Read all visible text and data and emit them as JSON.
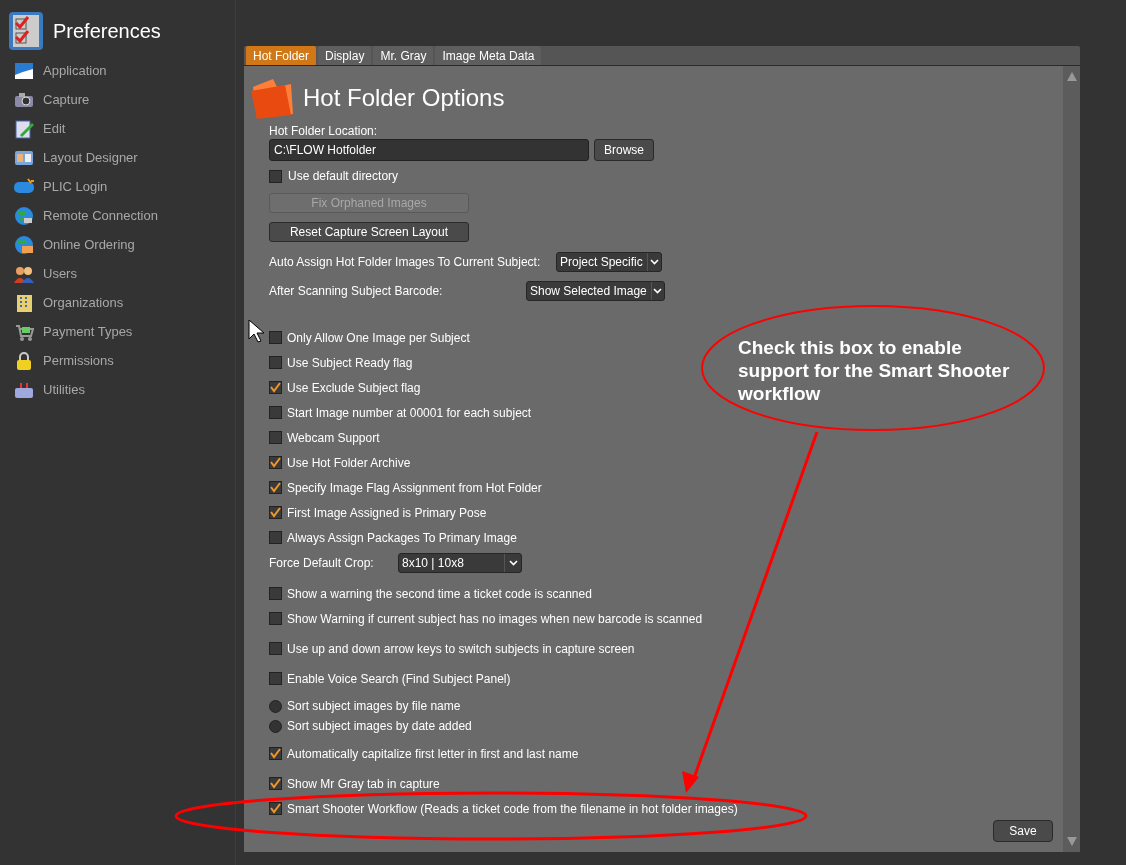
{
  "app": {
    "title": "Preferences"
  },
  "sidebar": {
    "items": [
      {
        "label": "Application"
      },
      {
        "label": "Capture"
      },
      {
        "label": "Edit"
      },
      {
        "label": "Layout Designer"
      },
      {
        "label": "PLIC Login"
      },
      {
        "label": "Remote Connection"
      },
      {
        "label": "Online Ordering"
      },
      {
        "label": "Users"
      },
      {
        "label": "Organizations"
      },
      {
        "label": "Payment Types"
      },
      {
        "label": "Permissions"
      },
      {
        "label": "Utilities"
      }
    ]
  },
  "tabs": [
    {
      "label": "Hot Folder",
      "selected": true
    },
    {
      "label": "Display",
      "selected": false
    },
    {
      "label": "Mr. Gray",
      "selected": false
    },
    {
      "label": "Image Meta Data",
      "selected": false
    }
  ],
  "heading": "Hot Folder Options",
  "location": {
    "label": "Hot Folder Location:",
    "value": "C:\\FLOW Hotfolder",
    "browse": "Browse"
  },
  "use_default": {
    "label": "Use default directory",
    "checked": false
  },
  "buttons": [
    {
      "label": "Fix Orphaned Images",
      "disabled": true
    },
    {
      "label": "Reset Capture Screen Layout",
      "disabled": false
    }
  ],
  "selects": [
    {
      "label": "Auto Assign Hot Folder Images To Current Subject:",
      "value": "Project Specific"
    },
    {
      "label": "After Scanning Subject Barcode:",
      "value": "Show Selected Image"
    }
  ],
  "option_groups": [
    [
      {
        "kind": "checkbox",
        "label": "Only Allow One Image per Subject",
        "checked": false
      },
      {
        "kind": "checkbox",
        "label": "Use Subject Ready flag",
        "checked": false
      },
      {
        "kind": "checkbox",
        "label": "Use Exclude Subject flag",
        "checked": true
      },
      {
        "kind": "checkbox",
        "label": "Start Image number at 00001 for each subject",
        "checked": false
      },
      {
        "kind": "checkbox",
        "label": "Webcam Support",
        "checked": false
      },
      {
        "kind": "checkbox",
        "label": "Use Hot Folder Archive",
        "checked": true
      },
      {
        "kind": "checkbox",
        "label": "Specify Image Flag Assignment from Hot Folder",
        "checked": true
      },
      {
        "kind": "checkbox",
        "label": "First Image Assigned is Primary Pose",
        "checked": true
      },
      {
        "kind": "checkbox",
        "label": "Always Assign Packages To Primary Image",
        "checked": false
      },
      {
        "kind": "dropdown",
        "label": "Force Default Crop:",
        "value": "8x10 | 10x8"
      }
    ],
    [
      {
        "kind": "checkbox",
        "label": "Show a warning the second time a ticket code is scanned",
        "checked": false
      },
      {
        "kind": "checkbox",
        "label": "Show Warning if current subject has no images when new barcode is scanned",
        "checked": false
      }
    ],
    [
      {
        "kind": "checkbox",
        "label": "Use up and down arrow keys to switch subjects in capture screen",
        "checked": false
      }
    ],
    [
      {
        "kind": "checkbox",
        "label": "Enable Voice Search (Find Subject Panel)",
        "checked": false
      }
    ],
    [
      {
        "kind": "radio",
        "label": "Sort subject images by file name",
        "selected": false
      },
      {
        "kind": "radio",
        "label": "Sort subject images by date added",
        "selected": false
      }
    ],
    [
      {
        "kind": "checkbox",
        "label": "Automatically capitalize first letter in first and last name",
        "checked": true
      }
    ],
    [
      {
        "kind": "checkbox",
        "label": "Show Mr Gray tab in capture",
        "checked": true
      },
      {
        "kind": "checkbox",
        "label": "Smart Shooter Workflow (Reads a ticket code from the filename in hot folder images)",
        "checked": true
      }
    ]
  ],
  "save": "Save",
  "annotation": {
    "text": "Check this box to enable support for the Smart Shooter workflow"
  }
}
